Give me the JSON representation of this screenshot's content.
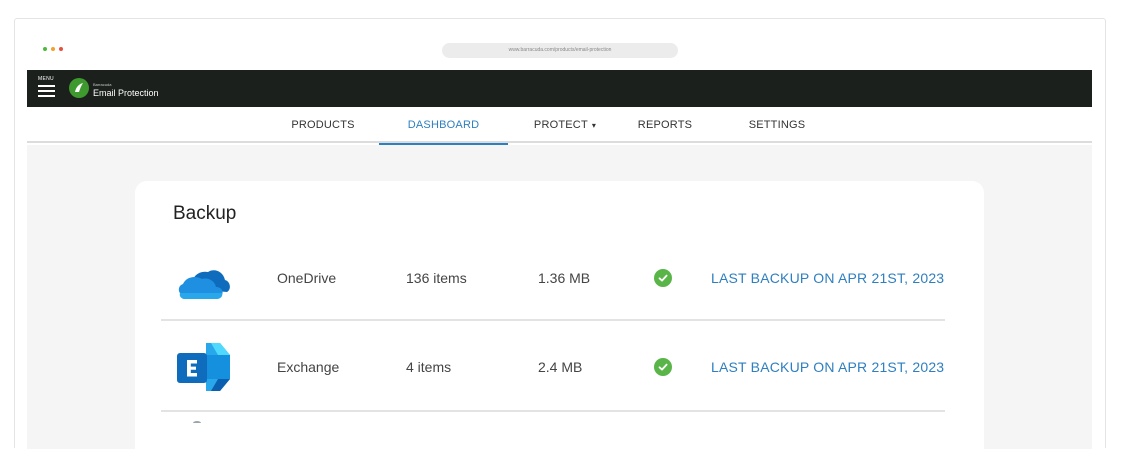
{
  "browser": {
    "url": "www.barracuda.com/products/email-protection",
    "dot_colors": [
      "#4cbb3a",
      "#f1a12e",
      "#e8503c"
    ]
  },
  "header": {
    "menu_label": "MENU",
    "brand_small": "Barracuda",
    "brand_name": "Email Protection",
    "brand_color": "#3e9a2f"
  },
  "nav": {
    "items": [
      {
        "label": "PRODUCTS"
      },
      {
        "label": "DASHBOARD",
        "active": true
      },
      {
        "label": "PROTECT"
      },
      {
        "label": "REPORTS"
      },
      {
        "label": "SETTINGS"
      }
    ],
    "accent": "#2e7fc0"
  },
  "backup": {
    "title": "Backup",
    "rows": [
      {
        "icon": "onedrive-icon",
        "service": "OneDrive",
        "items": "136 items",
        "size": "1.36 MB",
        "status": "check-icon",
        "last_backup": "LAST BACKUP ON APR 21ST, 2023"
      },
      {
        "icon": "exchange-icon",
        "service": "Exchange",
        "items": "4 items",
        "size": "2.4 MB",
        "status": "check-icon",
        "last_backup": "LAST BACKUP ON APR 21ST, 2023"
      }
    ],
    "status_color": "#59b548"
  }
}
